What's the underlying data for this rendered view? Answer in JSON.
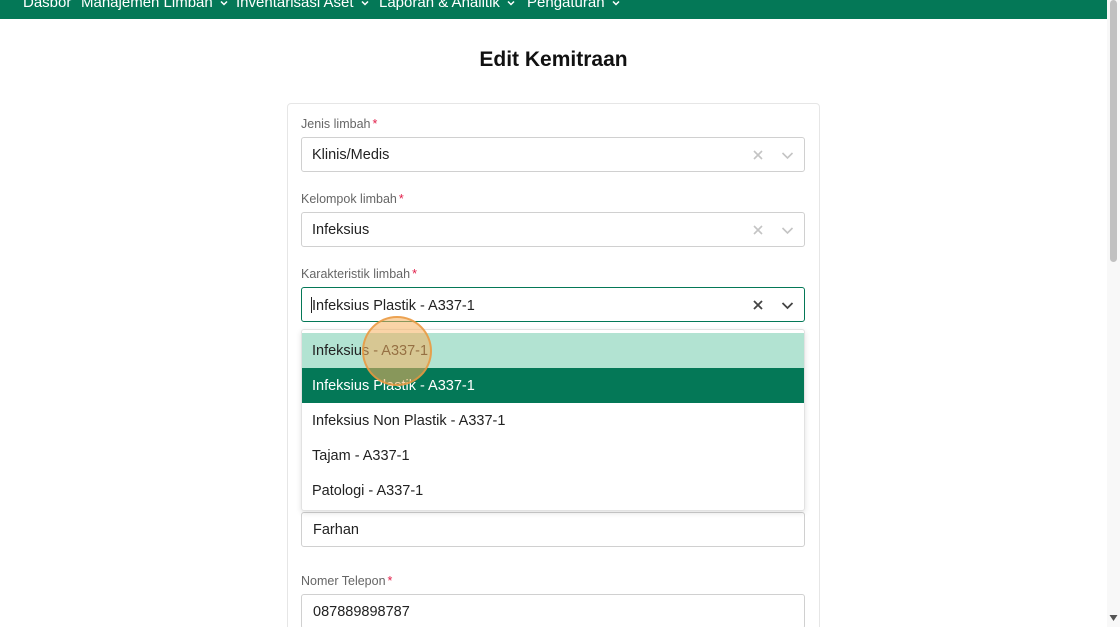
{
  "nav": {
    "items": [
      {
        "label": "Dasbor",
        "has_dropdown": false
      },
      {
        "label": "Manajemen Limbah",
        "has_dropdown": true
      },
      {
        "label": "Inventarisasi Aset",
        "has_dropdown": true
      },
      {
        "label": "Laporan & Analitik",
        "has_dropdown": true
      },
      {
        "label": "Pengaturan",
        "has_dropdown": true
      }
    ]
  },
  "page": {
    "title": "Edit Kemitraan"
  },
  "form": {
    "jenis": {
      "label": "Jenis limbah",
      "required_mark": "*",
      "value": "Klinis/Medis"
    },
    "kelompok": {
      "label": "Kelompok limbah",
      "required_mark": "*",
      "value": "Infeksius"
    },
    "karakteristik": {
      "label": "Karakteristik limbah",
      "required_mark": "*",
      "value": "Infeksius Plastik - A337-1"
    },
    "nama": {
      "value": "Farhan"
    },
    "telepon": {
      "label": "Nomer Telepon",
      "required_mark": "*",
      "value": "087889898787"
    }
  },
  "dropdown": {
    "options": [
      {
        "label": "Infeksius - A337-1",
        "state": "hover"
      },
      {
        "label": "Infeksius Plastik - A337-1",
        "state": "selected"
      },
      {
        "label": "Infeksius Non Plastik - A337-1",
        "state": "normal"
      },
      {
        "label": "Tajam - A337-1",
        "state": "normal"
      },
      {
        "label": "Patologi - A337-1",
        "state": "normal"
      }
    ]
  },
  "colors": {
    "brand": "#047857",
    "option_hover": "#b2e3d2",
    "required": "#e11d48",
    "cursor_highlight": "#f5b15f"
  },
  "icons": {
    "clear": "close-icon",
    "caret": "chevron-down-icon"
  }
}
